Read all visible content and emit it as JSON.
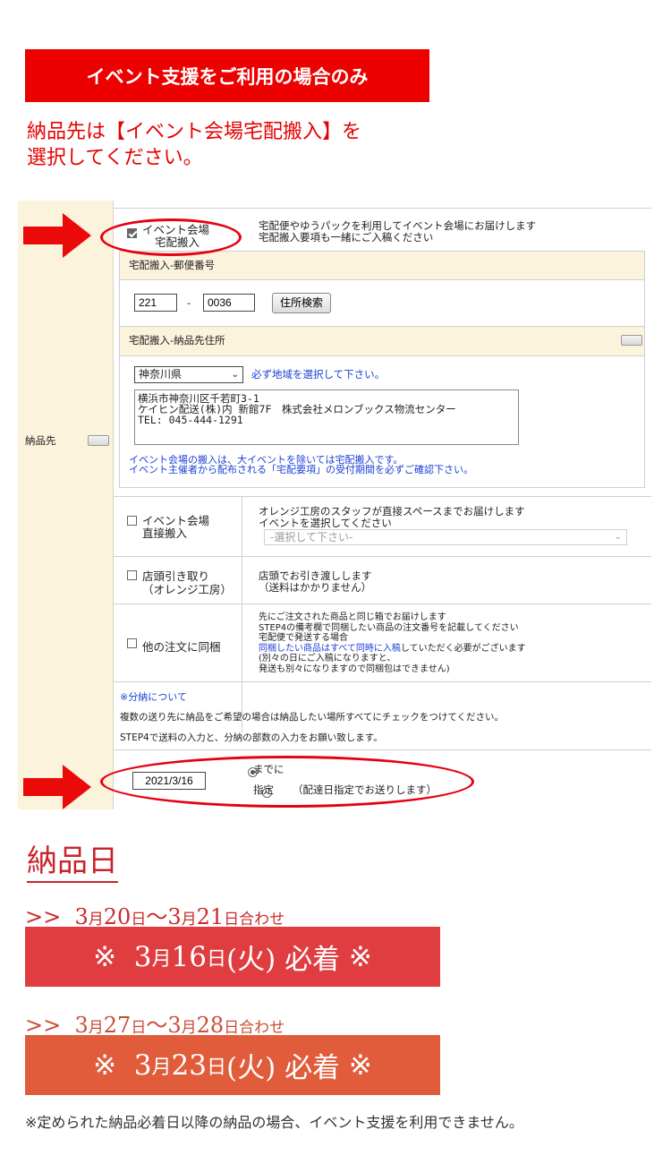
{
  "banner": "イベント支援をご利用の場合のみ",
  "intro": {
    "line1": "納品先は【イベント会場宅配搬入】を",
    "line2": "選択してください。"
  },
  "form": {
    "left_label": "納品先",
    "event_delivery": {
      "label1": "イベント会場",
      "label2": "宅配搬入",
      "checked": true,
      "desc1": "宅配便やゆうパックを利用してイベント会場にお届けします",
      "desc2": "宅配搬入要項も一緒にご入稿ください"
    },
    "postal_label": "宅配搬入-郵便番号",
    "postal1": "221",
    "postal_sep": "-",
    "postal2": "0036",
    "address_search": "住所検索",
    "address_label": "宅配搬入-納品先住所",
    "prefecture": "神奈川県",
    "region_note": "必ず地域を選択して下さい。",
    "address_lines": [
      "横浜市神奈川区千若町3-1",
      "ケイヒン配送(株)内 新館7F　株式会社メロンブックス物流センター",
      "TEL: 045-444-1291"
    ],
    "event_note1": "イベント会場の搬入は、大イベントを除いては宅配搬入です。",
    "event_note2": "イベント主催者から配布される「宅配要項」の受付期間を必ずご確認下さい。",
    "direct": {
      "label1": "イベント会場",
      "label2": "直接搬入",
      "desc1": "オレンジ工房のスタッフが直接スペースまでお届けします",
      "desc2": "イベントを選択してください",
      "select_placeholder": "-選択して下さい-"
    },
    "store": {
      "label1": "店頭引き取り",
      "label2": "（オレンジ工房）",
      "desc1": "店頭でお引き渡しします",
      "desc2": "（送料はかかりません）"
    },
    "combine": {
      "label": "他の注文に同梱",
      "desc1": "先にご注文された商品と同じ箱でお届けします",
      "desc2": "STEP4の備考欄で同梱したい商品の注文番号を記載してください",
      "desc3": "宅配便で発送する場合",
      "desc4_blue": "同梱したい商品はすべて同時に入稿",
      "desc4_rest": "していただく必要がございます",
      "desc5": "(別々の日にご入稿になりますと、",
      "desc6": "発送も別々になりますので同梱包はできません)"
    },
    "split_link": "※分納について",
    "split1": "複数の送り先に納品をご希望の場合は納品したい場所すべてにチェックをつけてください。",
    "split2": "STEP4で送料の入力と、分納の部数の入力をお願い致します。",
    "date_value": "2021/3/16",
    "radio_by": "までに",
    "radio_specify": "指定",
    "radio_specify_note": "（配達日指定でお送りします）"
  },
  "delivery_title": "納品日",
  "schedules": [
    {
      "range_prefix": ">>",
      "m1": "3",
      "d1": "20",
      "m2": "3",
      "d2": "21",
      "suffix": "日合わせ",
      "box_prefix": "※",
      "box_m": "3",
      "box_d": "16",
      "box_dow": "(火)",
      "box_text": "必着",
      "box_suffix": "※"
    },
    {
      "range_prefix": ">>",
      "m1": "3",
      "d1": "27",
      "m2": "3",
      "d2": "28",
      "suffix": "日合わせ",
      "box_prefix": "※",
      "box_m": "3",
      "box_d": "23",
      "box_dow": "(火)",
      "box_text": "必着",
      "box_suffix": "※"
    }
  ],
  "footnote": "※定められた納品必着日以降の納品の場合、イベント支援を利用できません。",
  "colors": {
    "banner_red": "#ec0000",
    "box1": "#e03d41",
    "box2": "#e05c3b",
    "accent_red": "#e60012"
  }
}
